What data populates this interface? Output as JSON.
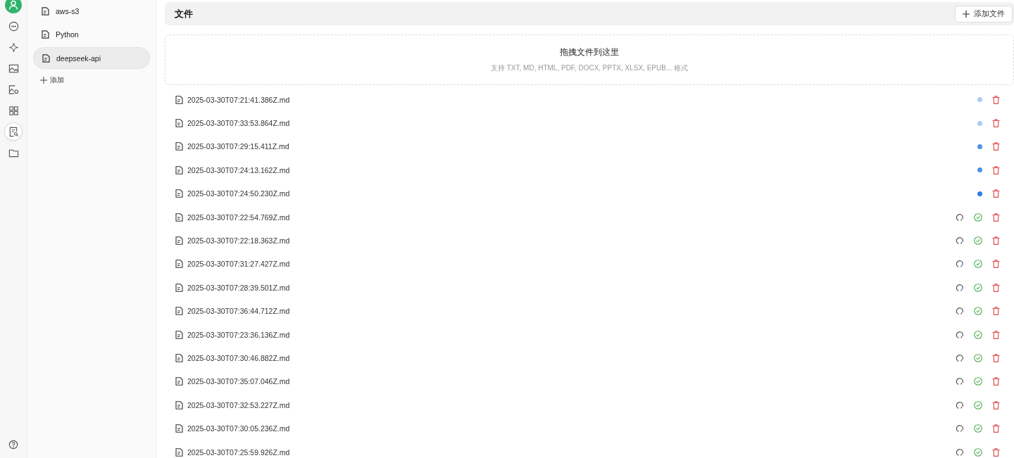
{
  "rail": {
    "items": [
      {
        "kind": "chat",
        "selected": false
      },
      {
        "kind": "sparkle",
        "selected": false
      },
      {
        "kind": "image",
        "selected": false
      },
      {
        "kind": "imageedit",
        "selected": false
      },
      {
        "kind": "grid",
        "selected": false
      },
      {
        "kind": "docsearch",
        "selected": true
      },
      {
        "kind": "folder",
        "selected": false
      }
    ]
  },
  "knowledge_bases": {
    "items": [
      {
        "label": "aws-s3",
        "selected": false
      },
      {
        "label": "Python",
        "selected": false
      },
      {
        "label": "deepseek-api",
        "selected": true
      }
    ],
    "add_label": "添加"
  },
  "header": {
    "title": "文件",
    "add_button": "添加文件"
  },
  "dropzone": {
    "title": "拖拽文件到这里",
    "hint": "支持 TXT, MD, HTML, PDF, DOCX, PPTX, XLSX, EPUB... 格式"
  },
  "files": [
    {
      "name": "2025-03-30T07:21:41.386Z.md",
      "kind": "pending",
      "color": "#a9cdf2"
    },
    {
      "name": "2025-03-30T07:33:53.864Z.md",
      "kind": "pending",
      "color": "#a9cdf2"
    },
    {
      "name": "2025-03-30T07:29:15.411Z.md",
      "kind": "pending",
      "color": "#4d94e3"
    },
    {
      "name": "2025-03-30T07:24:13.162Z.md",
      "kind": "pending",
      "color": "#4d94e3"
    },
    {
      "name": "2025-03-30T07:24:50.230Z.md",
      "kind": "pending",
      "color": "#2f7ddf"
    },
    {
      "name": "2025-03-30T07:22:54.769Z.md",
      "kind": "done"
    },
    {
      "name": "2025-03-30T07:22:18.363Z.md",
      "kind": "done"
    },
    {
      "name": "2025-03-30T07:31:27.427Z.md",
      "kind": "done"
    },
    {
      "name": "2025-03-30T07:28:39.501Z.md",
      "kind": "done"
    },
    {
      "name": "2025-03-30T07:36:44.712Z.md",
      "kind": "done"
    },
    {
      "name": "2025-03-30T07:23:36.136Z.md",
      "kind": "done"
    },
    {
      "name": "2025-03-30T07:30:46.882Z.md",
      "kind": "done"
    },
    {
      "name": "2025-03-30T07:35:07.046Z.md",
      "kind": "done"
    },
    {
      "name": "2025-03-30T07:32:53.227Z.md",
      "kind": "done"
    },
    {
      "name": "2025-03-30T07:30:05.236Z.md",
      "kind": "done"
    },
    {
      "name": "2025-03-30T07:25:59.926Z.md",
      "kind": "done"
    }
  ]
}
